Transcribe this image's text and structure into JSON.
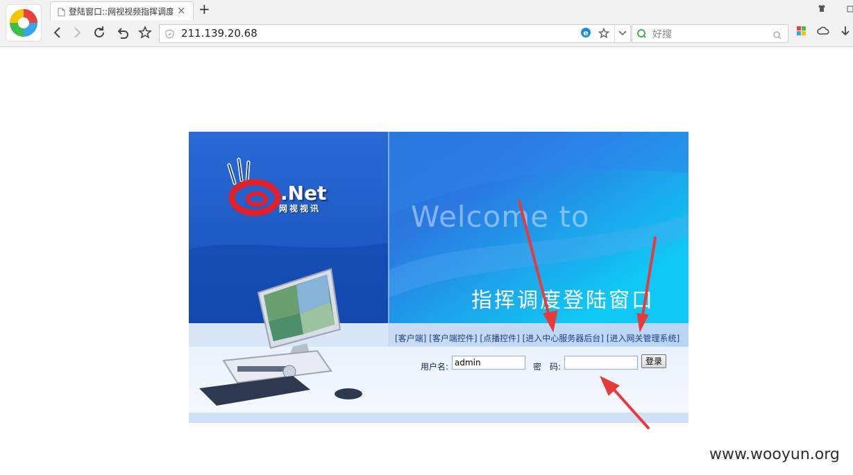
{
  "browser": {
    "tab_title": "登陆窗口::网视视频指挥调度",
    "tab_close": "×",
    "new_tab": "+",
    "address": "211.139.20.68",
    "search_placeholder": "好搜"
  },
  "page": {
    "brand_name": ".Net",
    "brand_sub": "网视视讯",
    "welcome": "Welcome to",
    "heading": "指挥调度登陆窗口",
    "links": [
      "[客户端]",
      "[客户端控件]",
      "[点播控件]",
      "[进入中心服务器后台]",
      "[进入网关管理系统]"
    ],
    "form": {
      "username_label": "用户名:",
      "username_value": "admin",
      "password_label": "密　码:",
      "password_value": "",
      "login_button": "登录"
    }
  },
  "watermark": "www.wooyun.org",
  "colors": {
    "annotation_arrow": "#e83a3a",
    "panel_blue": "#1a55c6",
    "link_color": "#1f3d8a"
  }
}
